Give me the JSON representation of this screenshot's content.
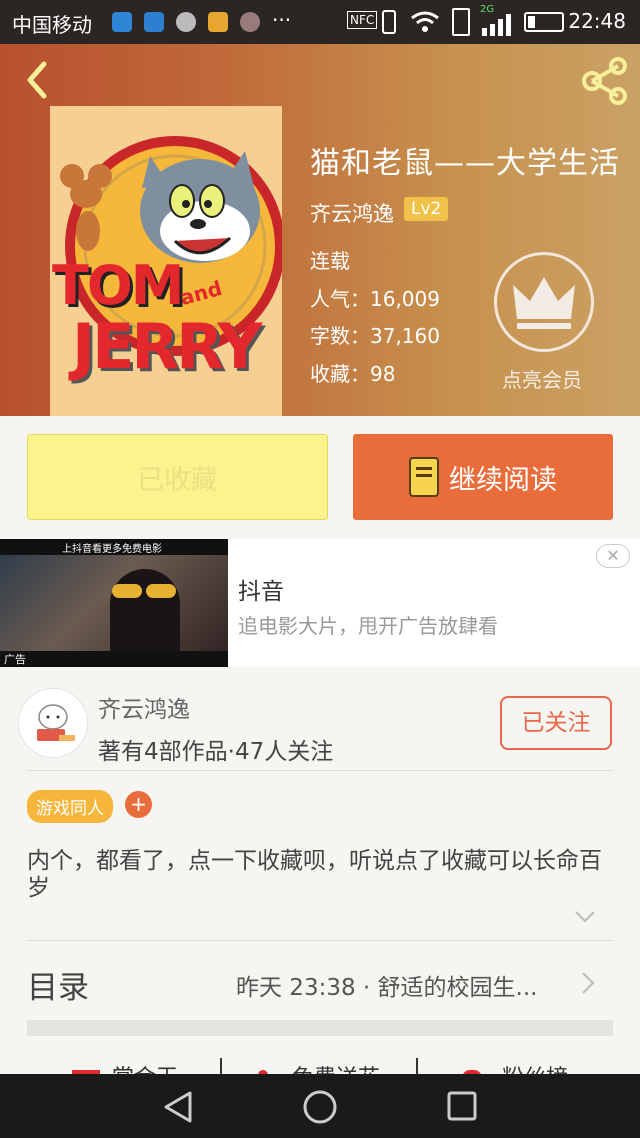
{
  "status_bar": {
    "carrier": "中国移动",
    "time": "22:48",
    "ellipsis": "···",
    "nfc": "NFC",
    "network": "2G"
  },
  "book": {
    "title": "猫和老鼠——大学生活",
    "author": "齐云鸿逸",
    "level": "Lv2",
    "status": "连载",
    "popularity": "人气：16,009",
    "words": "字数：37,160",
    "favorites": "收藏：98",
    "vip_label": "点亮会员",
    "cover_text": {
      "tom": "TOM",
      "and": "and",
      "jerry": "JERRY"
    }
  },
  "actions": {
    "collected_label": "已收藏",
    "read_label": "继续阅读"
  },
  "ad": {
    "title": "抖音",
    "subtitle": "追电影大片，甩开广告放肆看",
    "banner_text": "上抖音看更多免费电影",
    "ad_tag": "广告",
    "close": "✕"
  },
  "author_card": {
    "name": "齐云鸿逸",
    "info": "著有4部作品·47人关注",
    "follow_label": "已关注"
  },
  "tags": {
    "tag1": "游戏同人",
    "add": "+"
  },
  "description": "内个，都看了，点一下收藏呗，听说点了收藏可以长命百岁",
  "toc": {
    "label": "目录",
    "latest": "昨天 23:38 · 舒适的校园生..."
  },
  "bottom_tabs": [
    "赏金王",
    "免费送花",
    "粉丝榜"
  ],
  "colors": {
    "accent": "#e96c3b",
    "collect_bg": "#fbf38e",
    "tag": "#f5b63b"
  }
}
